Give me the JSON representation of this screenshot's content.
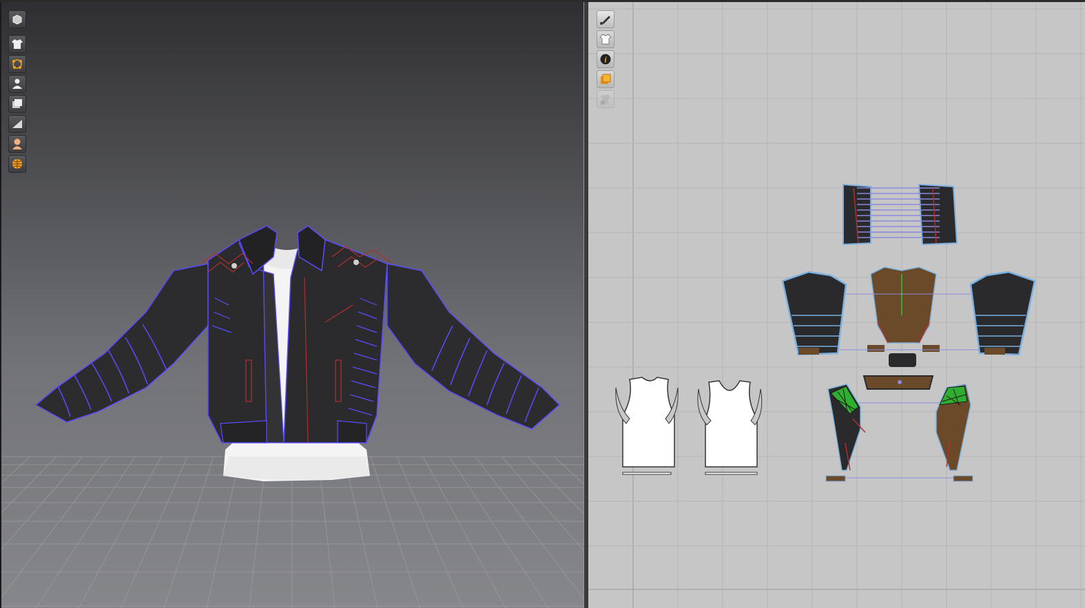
{
  "app": {
    "panels": [
      "3d-garment-window",
      "2d-pattern-window"
    ]
  },
  "toolbar_3d": {
    "buttons": [
      {
        "icon": "view-cube-icon",
        "selected": false
      },
      {
        "icon": "show-garment-icon",
        "selected": false
      },
      {
        "icon": "show-points-icon",
        "selected": false
      },
      {
        "icon": "show-avatar-icon",
        "selected": false
      },
      {
        "icon": "texture-view-icon",
        "selected": false
      },
      {
        "icon": "shading-mode-icon",
        "selected": false
      },
      {
        "icon": "avatar-skin-icon",
        "selected": false
      },
      {
        "icon": "grid-globe-icon",
        "selected": false
      }
    ]
  },
  "toolbar_2d": {
    "buttons": [
      {
        "icon": "show-tool-icon",
        "selected": true
      },
      {
        "icon": "show-garment-2d-icon",
        "selected": false
      },
      {
        "icon": "pattern-info-icon",
        "selected": false
      },
      {
        "icon": "fabric-layer-icon",
        "selected": false
      },
      {
        "icon": "lock-garment-icon",
        "selected": false,
        "disabled": true
      }
    ]
  },
  "colors": {
    "jacket": "#2a2a2c",
    "seam_blue": "#5a4cff",
    "stitch_red": "#b03030",
    "lining_brown": "#6b4a2a",
    "quilt_green": "#2fae2f",
    "pattern_outline": "#7ab0e0",
    "shirt_white": "#ffffff",
    "pattern_bg": "#c6c6c6"
  }
}
